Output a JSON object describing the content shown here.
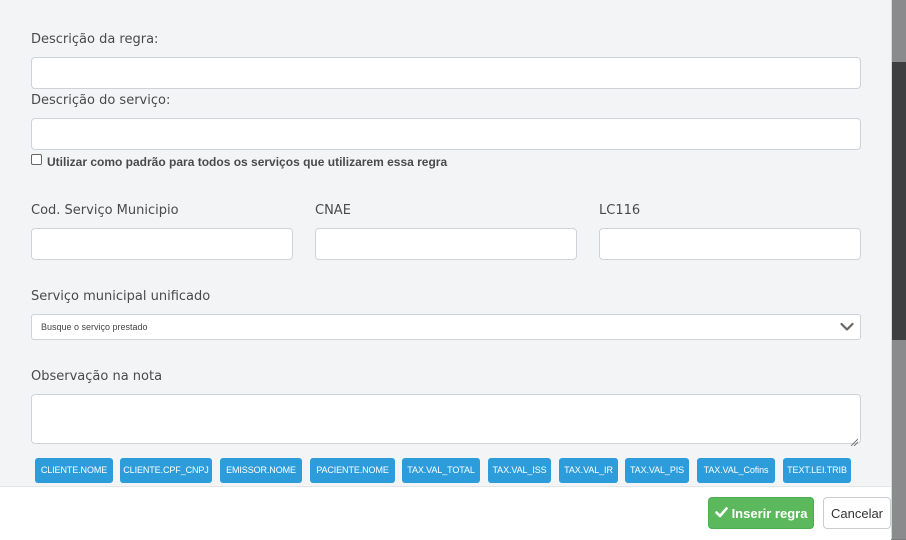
{
  "form": {
    "rule_description_label": "Descrição da regra:",
    "service_description_label": "Descrição do serviço:",
    "default_checkbox_label": "Utilizar como padrão para todos os serviços que utilizarem essa regra",
    "municipal_code_label": "Cod. Serviço Municipio",
    "cnae_label": "CNAE",
    "lc116_label": "LC116",
    "unified_service_label": "Serviço municipal unificado",
    "unified_service_placeholder": "Busque o serviço prestado",
    "observation_label": "Observação na nota"
  },
  "tags": [
    "CLIENTE.NOME",
    "CLIENTE.CPF_CNPJ",
    "EMISSOR.NOME",
    "PACIENTE.NOME",
    "TAX.VAL_TOTAL",
    "TAX.VAL_ISS",
    "TAX.VAL_IR",
    "TAX.VAL_PIS",
    "TAX.VAL_Cofins",
    "TEXT.LEI.TRIB"
  ],
  "footer": {
    "insert_label": "Inserir regra",
    "cancel_label": "Cancelar"
  },
  "colors": {
    "tag_bg": "#2d9cdb",
    "primary_button": "#5cb85c"
  },
  "icons": {
    "insert": "check-icon",
    "select": "chevron-down-icon"
  }
}
